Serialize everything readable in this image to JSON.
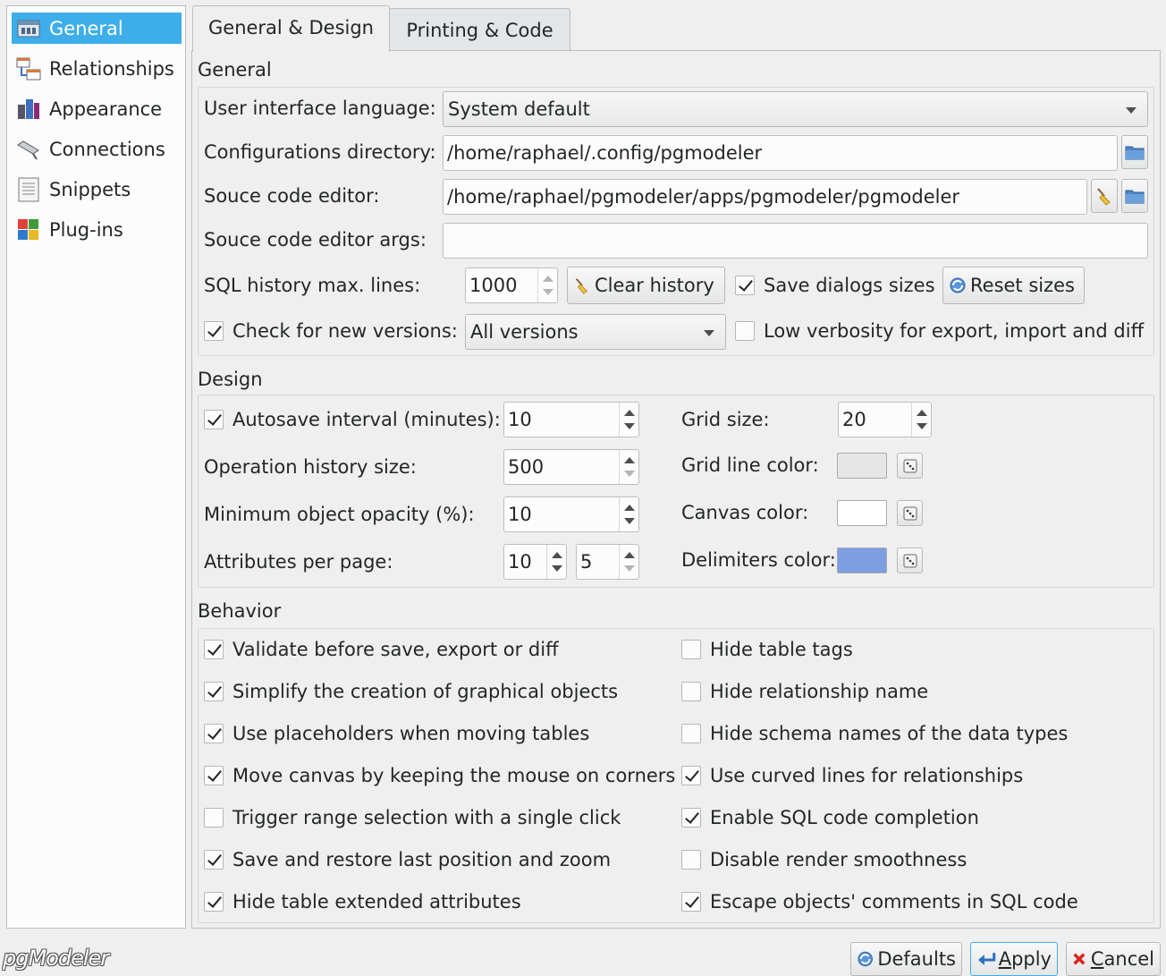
{
  "sidebar": {
    "items": [
      {
        "label": "General",
        "icon": "general-icon",
        "selected": true
      },
      {
        "label": "Relationships",
        "icon": "relationships-icon"
      },
      {
        "label": "Appearance",
        "icon": "appearance-icon"
      },
      {
        "label": "Connections",
        "icon": "connections-icon"
      },
      {
        "label": "Snippets",
        "icon": "snippets-icon"
      },
      {
        "label": "Plug-ins",
        "icon": "plugins-icon"
      }
    ]
  },
  "tabs": [
    {
      "label": "General & Design",
      "active": true
    },
    {
      "label": "Printing & Code",
      "active": false
    }
  ],
  "general": {
    "title": "General",
    "ui_language_label": "User interface language:",
    "ui_language_value": "System default",
    "config_dir_label": "Configurations directory:",
    "config_dir_value": "/home/raphael/.config/pgmodeler",
    "editor_label": "Souce code editor:",
    "editor_value": "/home/raphael/pgmodeler/apps/pgmodeler/pgmodeler",
    "editor_args_label": "Souce code editor args:",
    "editor_args_value": "",
    "sql_history_label": "SQL history max. lines:",
    "sql_history_value": "1000",
    "clear_history_label": "Clear history",
    "save_dialogs_label": "Save dialogs sizes",
    "save_dialogs_checked": true,
    "reset_sizes_label": "Reset sizes",
    "check_versions_label": "Check for new versions:",
    "check_versions_checked": true,
    "versions_value": "All versions",
    "low_verbosity_label": "Low verbosity for export, import and diff",
    "low_verbosity_checked": false
  },
  "design": {
    "title": "Design",
    "autosave_label": "Autosave interval (minutes):",
    "autosave_checked": true,
    "autosave_value": "10",
    "op_history_label": "Operation history size:",
    "op_history_value": "500",
    "opacity_label": "Minimum object opacity (%):",
    "opacity_value": "10",
    "attrs_label": "Attributes per page:",
    "attrs_value1": "10",
    "attrs_value2": "5",
    "grid_size_label": "Grid size:",
    "grid_size_value": "20",
    "grid_color_label": "Grid line color:",
    "canvas_color_label": "Canvas color:",
    "delim_color_label": "Delimiters color:",
    "colors": {
      "grid_line": "#e6e6e6",
      "canvas": "#ffffff",
      "delimiters": "#7d9ee3"
    }
  },
  "behavior": {
    "title": "Behavior",
    "left": [
      {
        "label": "Validate before save, export or diff",
        "checked": true
      },
      {
        "label": "Simplify the creation of graphical objects",
        "checked": true
      },
      {
        "label": "Use placeholders when moving tables",
        "checked": true
      },
      {
        "label": "Move canvas by keeping the mouse on corners",
        "checked": true
      },
      {
        "label": "Trigger range selection with a single click",
        "checked": false
      },
      {
        "label": "Save and restore last position and zoom",
        "checked": true
      },
      {
        "label": "Hide table extended attributes",
        "checked": true
      }
    ],
    "right": [
      {
        "label": "Hide table tags",
        "checked": false
      },
      {
        "label": "Hide relationship name",
        "checked": false
      },
      {
        "label": "Hide schema names of the data types",
        "checked": false
      },
      {
        "label": "Use curved lines for relationships",
        "checked": true
      },
      {
        "label": "Enable SQL code completion",
        "checked": true
      },
      {
        "label": "Disable render smoothness",
        "checked": false
      },
      {
        "label": "Escape objects' comments in SQL code",
        "checked": true
      }
    ]
  },
  "footer": {
    "logo_text": "pgModeler",
    "defaults_label": "Defaults",
    "apply_label": "Apply",
    "cancel_label": "Cancel"
  }
}
